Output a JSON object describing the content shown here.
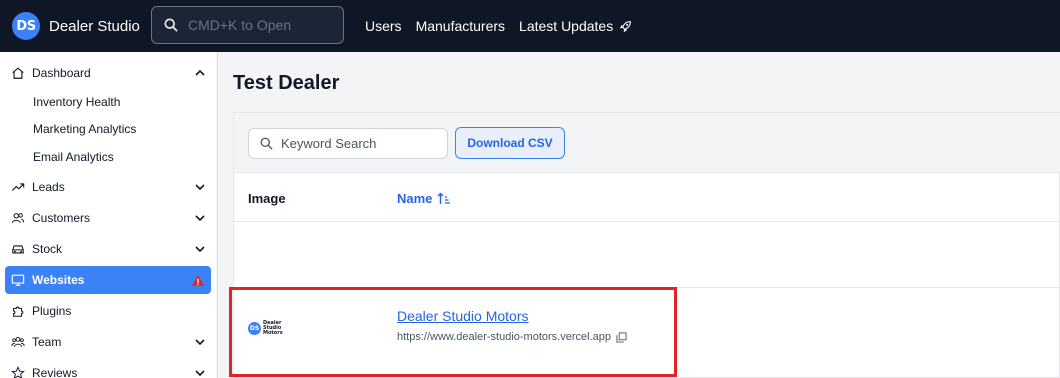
{
  "topbar": {
    "logo_text": "DS",
    "brand_name": "Dealer Studio",
    "search_placeholder": "CMD+K to Open",
    "nav": [
      "Users",
      "Manufacturers",
      "Latest Updates"
    ]
  },
  "sidebar": {
    "dashboard": "Dashboard",
    "dashboard_sub": [
      "Inventory Health",
      "Marketing Analytics",
      "Email Analytics"
    ],
    "leads": "Leads",
    "customers": "Customers",
    "stock": "Stock",
    "websites": "Websites",
    "plugins": "Plugins",
    "team": "Team",
    "reviews": "Reviews"
  },
  "main": {
    "title": "Test Dealer",
    "keyword_placeholder": "Keyword Search",
    "download_csv": "Download CSV",
    "columns": {
      "image": "Image",
      "name": "Name"
    },
    "rows": [
      {
        "logo_text": "DS",
        "logo_caption": "Dealer Studio Motors",
        "name": "Dealer Studio Motors",
        "url": "https://www.dealer-studio-motors.vercel.app"
      }
    ]
  },
  "colors": {
    "topbar_bg": "#0f1727",
    "accent": "#3b82f6",
    "link": "#2563eb",
    "highlight": "#dc2626",
    "warning": "#dc2626"
  },
  "icons": {
    "search": "magnifier-icon",
    "latest_updates": "rocket-icon",
    "dashboard": "home-icon",
    "leads": "trend-up-icon",
    "customers": "users-icon",
    "stock": "car-icon",
    "websites": "monitor-icon",
    "websites_status": "warning-icon",
    "plugins": "puzzle-icon",
    "team": "team-icon",
    "reviews": "star-icon",
    "sort": "sort-ascending-icon",
    "copy": "copy-icon"
  }
}
